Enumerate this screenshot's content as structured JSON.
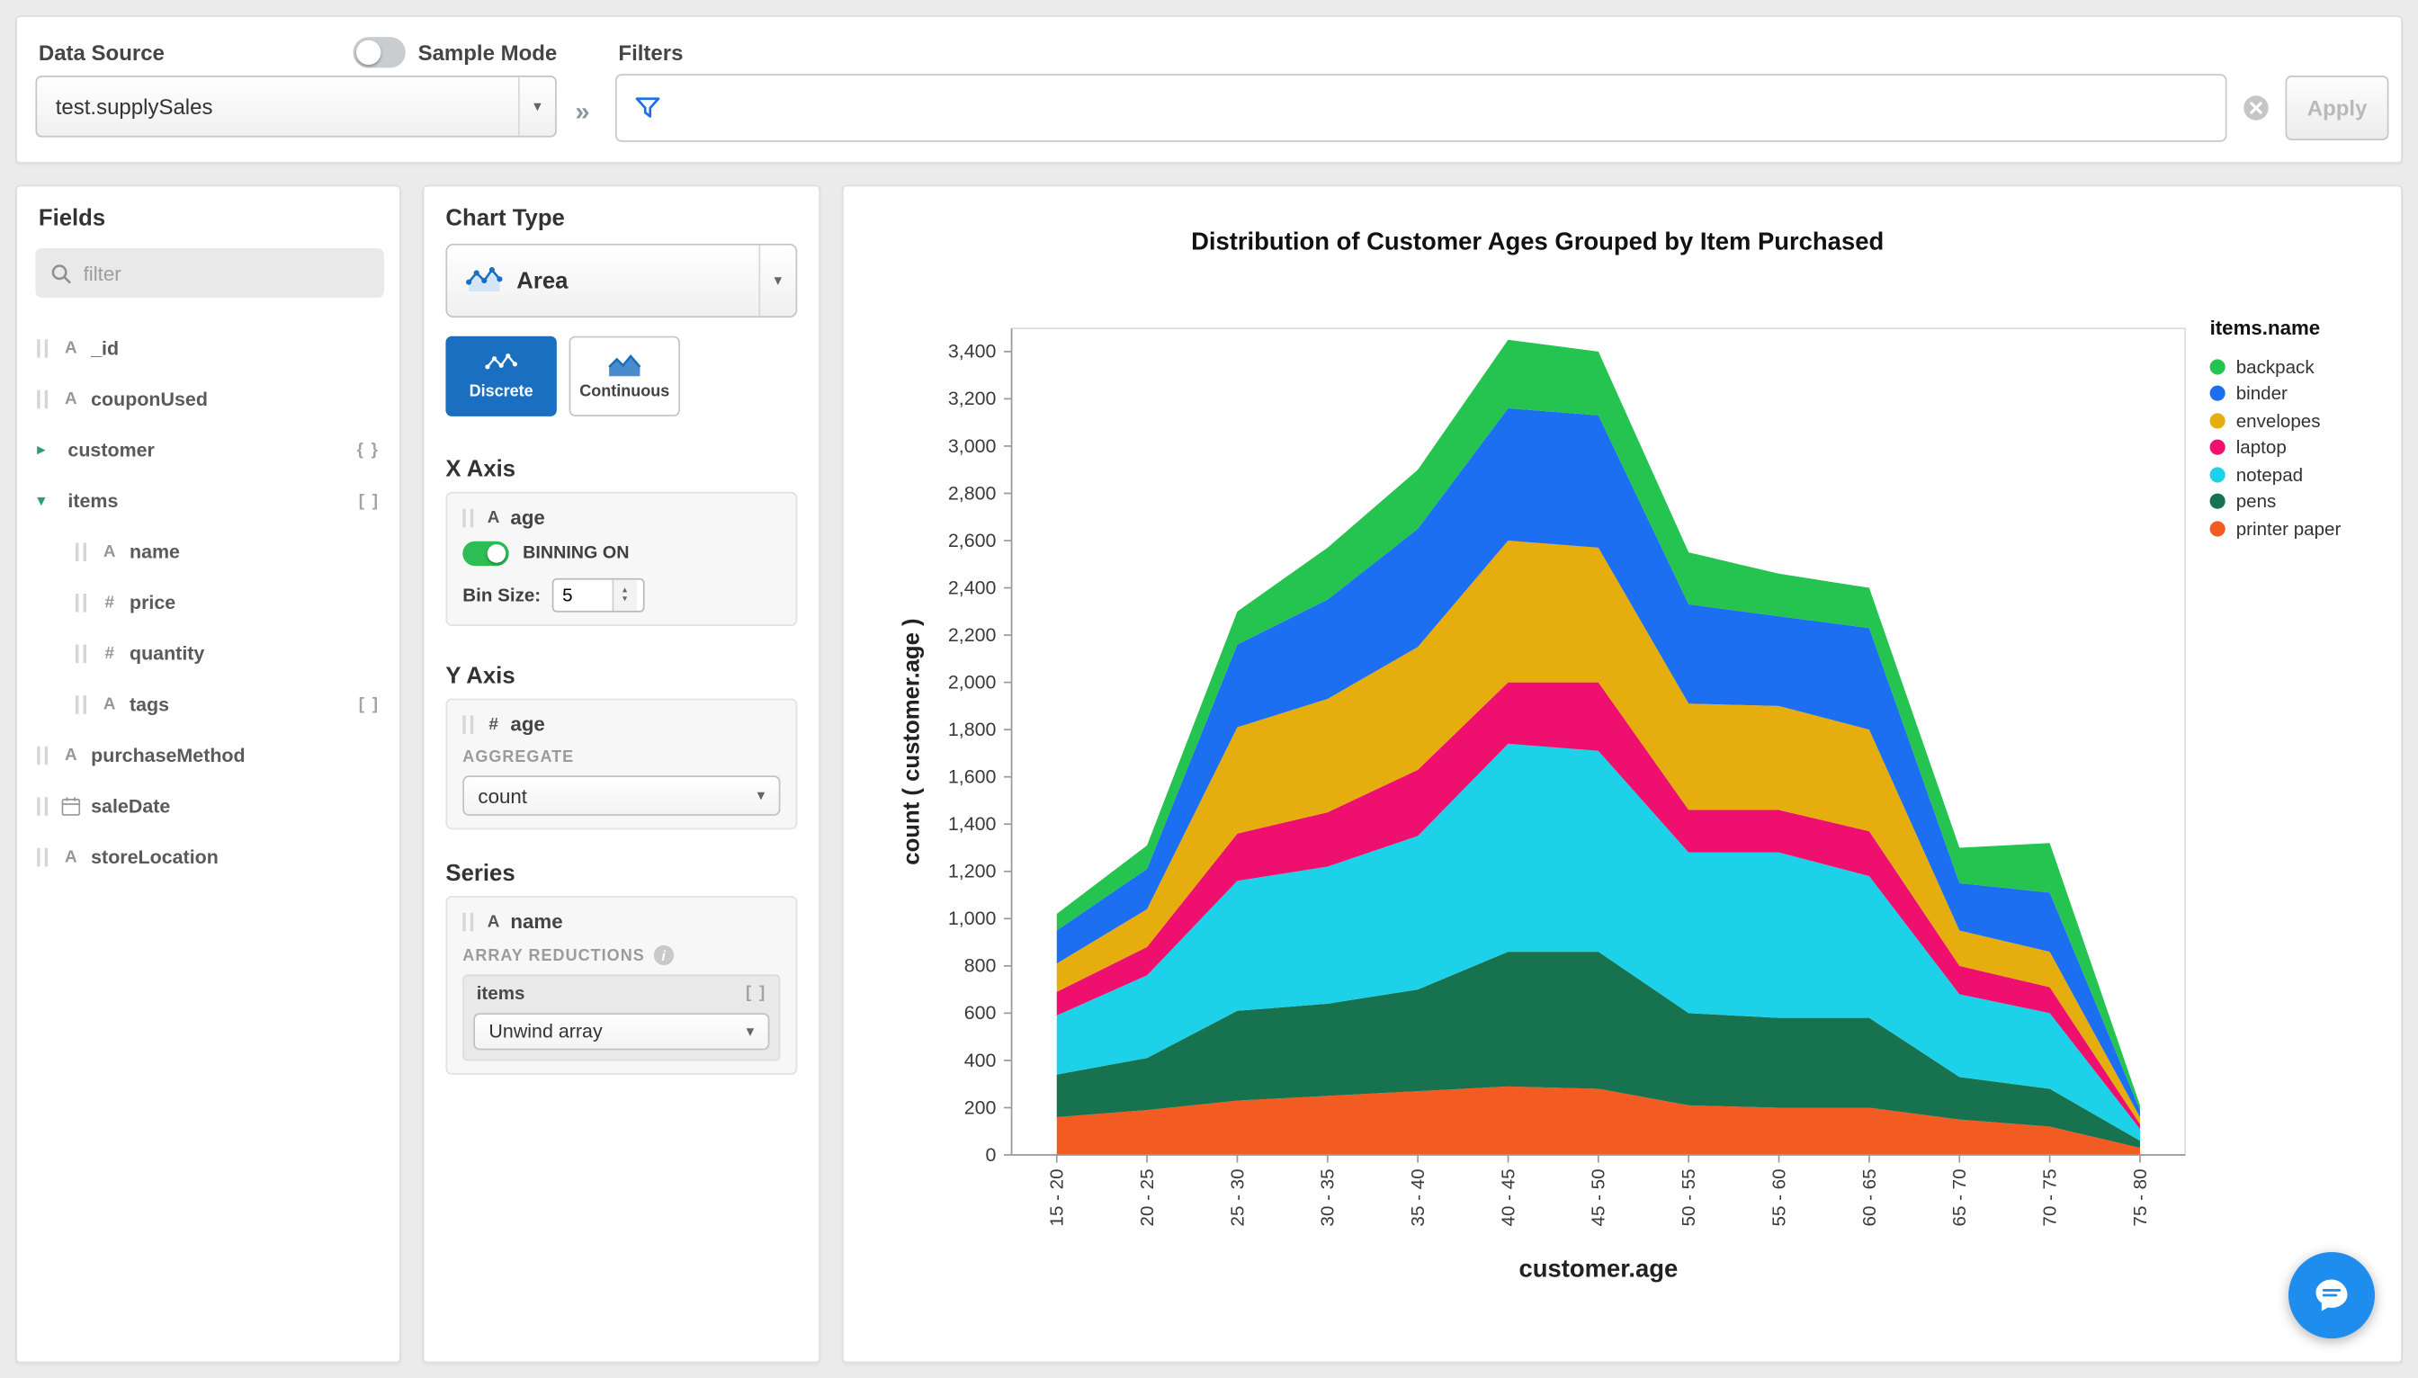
{
  "topbar": {
    "data_source_label": "Data Source",
    "sample_mode_label": "Sample Mode",
    "data_source_value": "test.supplySales",
    "collapse_glyph": "»",
    "filters_label": "Filters",
    "apply_label": "Apply"
  },
  "icons": {
    "caret": "▾",
    "spin_up": "▴",
    "spin_down": "▾",
    "tree_collapsed": "▸",
    "tree_expanded": "▾",
    "string_glyph": "A",
    "number_glyph": "#",
    "info_glyph": "i"
  },
  "fields_panel": {
    "title": "Fields",
    "filter_placeholder": "filter",
    "items": [
      {
        "name": "_id",
        "type": "string"
      },
      {
        "name": "couponUsed",
        "type": "string"
      },
      {
        "name": "customer",
        "type": "object",
        "expanded": false,
        "badge": "{ }"
      },
      {
        "name": "items",
        "type": "array",
        "expanded": true,
        "badge": "[ ]"
      },
      {
        "name": "name",
        "type": "string",
        "indent": 1
      },
      {
        "name": "price",
        "type": "number",
        "indent": 1
      },
      {
        "name": "quantity",
        "type": "number",
        "indent": 1
      },
      {
        "name": "tags",
        "type": "string",
        "indent": 1,
        "badge": "[ ]"
      },
      {
        "name": "purchaseMethod",
        "type": "string"
      },
      {
        "name": "saleDate",
        "type": "date"
      },
      {
        "name": "storeLocation",
        "type": "string"
      }
    ]
  },
  "chart_panel": {
    "title": "Chart Type",
    "type_value": "Area",
    "discrete_label": "Discrete",
    "continuous_label": "Continuous",
    "x_axis": {
      "title": "X Axis",
      "field": "age",
      "binning_label": "BINNING ON",
      "bin_size_label": "Bin Size:",
      "bin_size_value": "5"
    },
    "y_axis": {
      "title": "Y Axis",
      "field": "age",
      "aggregate_label": "AGGREGATE",
      "aggregate_value": "count"
    },
    "series": {
      "title": "Series",
      "field": "name",
      "array_reductions_label": "ARRAY REDUCTIONS",
      "array_field": "items",
      "array_badge": "[ ]",
      "reduction_value": "Unwind array"
    }
  },
  "chart_data": {
    "type": "area",
    "stacked": true,
    "title": "Distribution of Customer Ages Grouped by Item Purchased",
    "xlabel": "customer.age",
    "ylabel": "count ( customer.age )",
    "legend_title": "items.name",
    "legend_position": "right",
    "grid": false,
    "categories": [
      "15 - 20",
      "20 - 25",
      "25 - 30",
      "30 - 35",
      "35 - 40",
      "40 - 45",
      "45 - 50",
      "50 - 55",
      "55 - 60",
      "60 - 65",
      "65 - 70",
      "70 - 75",
      "75 - 80"
    ],
    "ylim": [
      0,
      3400
    ],
    "y_tick_step": 200,
    "series": [
      {
        "name": "backpack",
        "color": "#25c34f",
        "values": [
          70,
          100,
          140,
          220,
          250,
          290,
          270,
          220,
          180,
          170,
          150,
          210,
          20
        ]
      },
      {
        "name": "binder",
        "color": "#1d6ff2",
        "values": [
          140,
          170,
          350,
          420,
          500,
          560,
          560,
          420,
          380,
          430,
          200,
          250,
          30
        ]
      },
      {
        "name": "envelopes",
        "color": "#e6ad0e",
        "values": [
          120,
          160,
          450,
          480,
          520,
          600,
          570,
          450,
          440,
          430,
          150,
          150,
          30
        ]
      },
      {
        "name": "laptop",
        "color": "#ef0f6e",
        "values": [
          100,
          120,
          200,
          230,
          280,
          260,
          290,
          180,
          180,
          190,
          120,
          110,
          20
        ]
      },
      {
        "name": "notepad",
        "color": "#1dd2e8",
        "values": [
          250,
          350,
          550,
          580,
          650,
          880,
          850,
          680,
          700,
          600,
          350,
          320,
          50
        ]
      },
      {
        "name": "pens",
        "color": "#177250",
        "values": [
          180,
          220,
          380,
          390,
          430,
          570,
          580,
          390,
          380,
          380,
          180,
          160,
          30
        ]
      },
      {
        "name": "printer paper",
        "color": "#f25b21",
        "values": [
          160,
          190,
          230,
          250,
          270,
          290,
          280,
          210,
          200,
          200,
          150,
          120,
          30
        ]
      }
    ],
    "stack_order_bottom_to_top": [
      "printer paper",
      "pens",
      "notepad",
      "laptop",
      "envelopes",
      "binder",
      "backpack"
    ]
  },
  "colors": {
    "accent_blue": "#1b6fc0",
    "toggle_green": "#2dbd55",
    "funnel_blue": "#1f70e8",
    "intercom_blue": "#1f8ded"
  }
}
